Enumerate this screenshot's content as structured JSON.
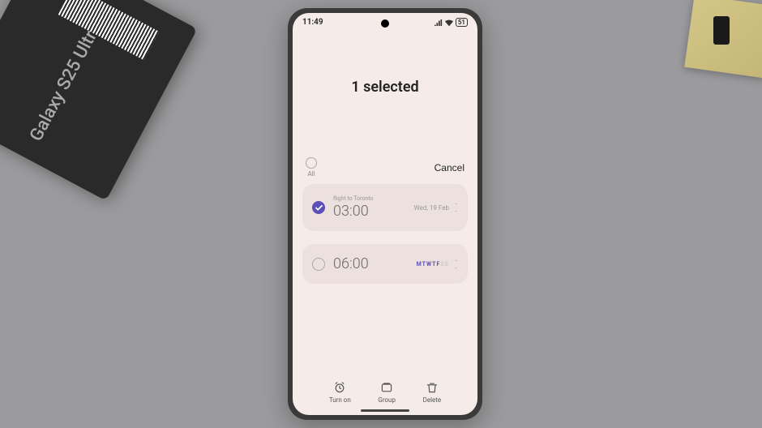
{
  "product_box": {
    "text": "Galaxy S25 Ultra"
  },
  "status_bar": {
    "time": "11:49",
    "battery": "51"
  },
  "page": {
    "title": "1 selected"
  },
  "header": {
    "all_label": "All",
    "cancel_label": "Cancel"
  },
  "alarms": [
    {
      "label": "flight to Toronto",
      "time": "03:00",
      "date": "Wed, 19 Feb",
      "selected": true
    },
    {
      "label": "",
      "time": "06:00",
      "days_active": "MTWTF",
      "days_inactive": "SS",
      "selected": false
    }
  ],
  "bottom_actions": {
    "turn_on_label": "Turn on",
    "group_label": "Group",
    "delete_label": "Delete"
  }
}
